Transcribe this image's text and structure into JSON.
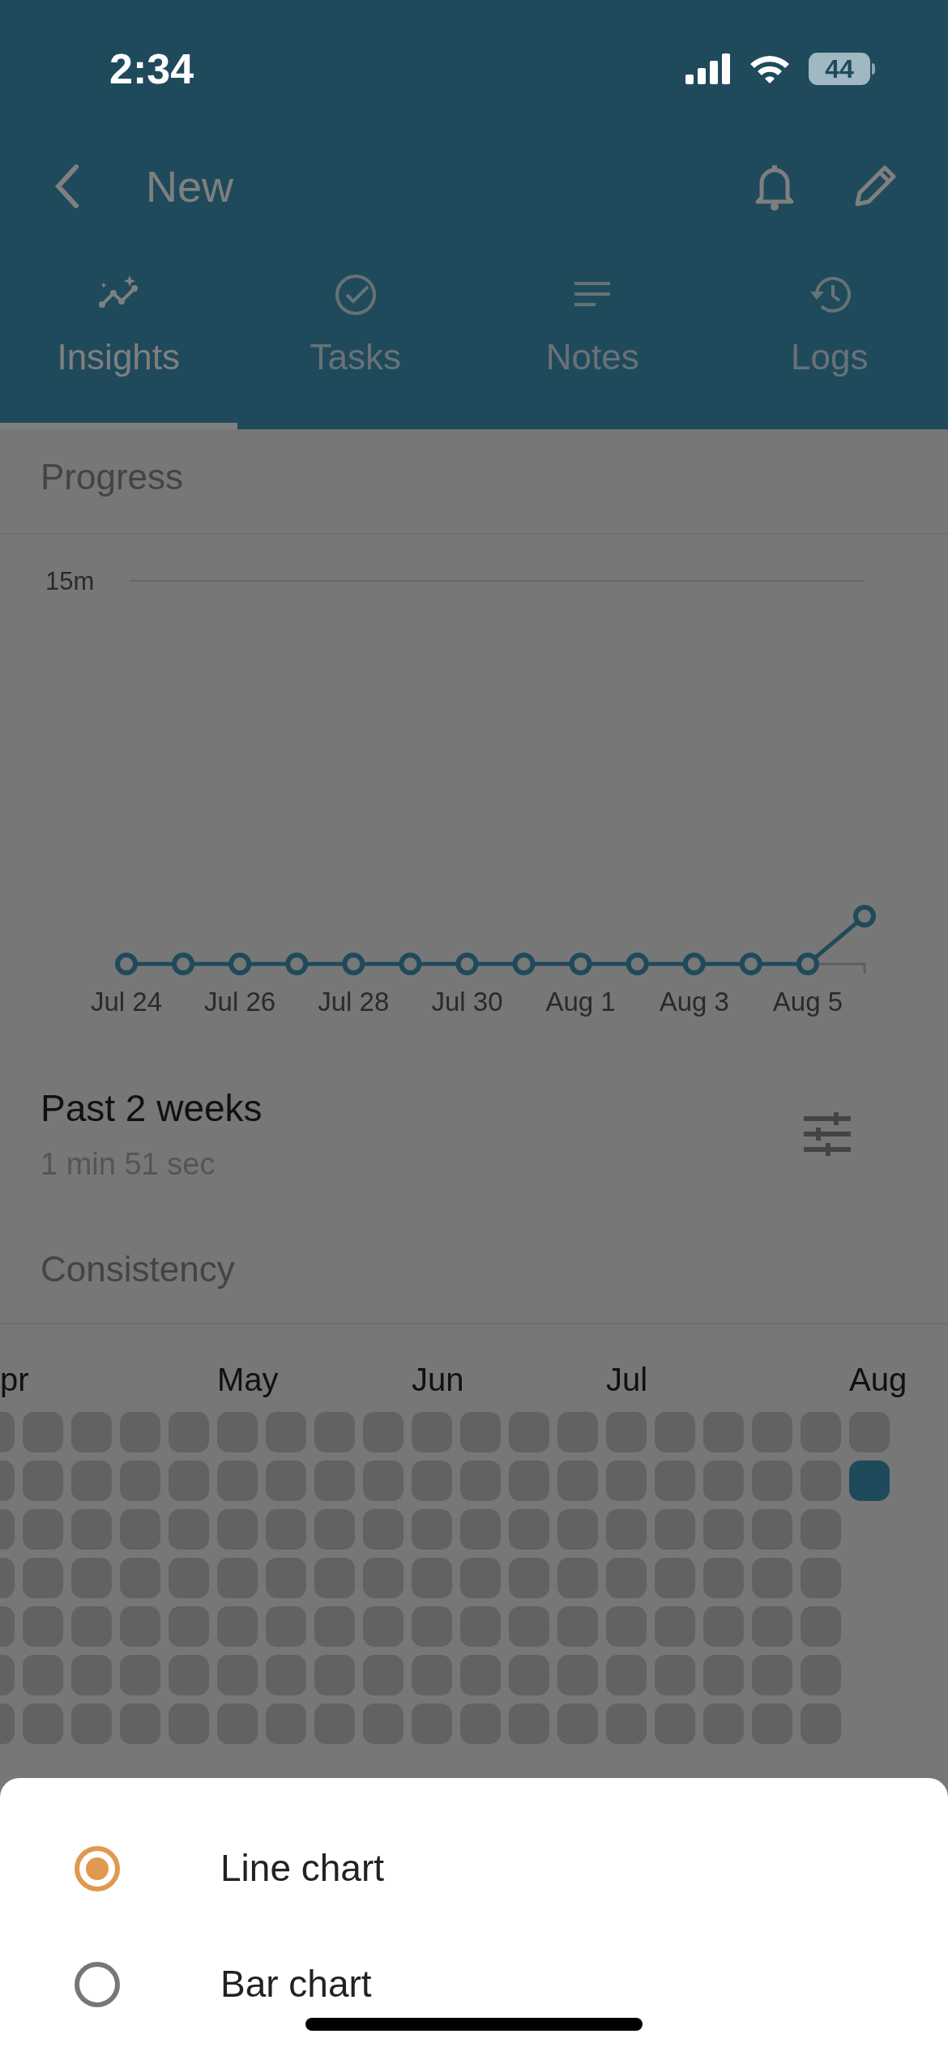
{
  "status_bar": {
    "time": "2:34",
    "battery": "44"
  },
  "header": {
    "title": "New"
  },
  "tabs": [
    {
      "label": "Insights",
      "selected": true
    },
    {
      "label": "Tasks",
      "selected": false
    },
    {
      "label": "Notes",
      "selected": false
    },
    {
      "label": "Logs",
      "selected": false
    }
  ],
  "progress": {
    "title": "Progress",
    "chart": {
      "y_label": "15m",
      "x_labels": [
        "Jul 24",
        "Jul 26",
        "Jul 28",
        "Jul 30",
        "Aug 1",
        "Aug 3",
        "Aug 5"
      ]
    },
    "period": "Past 2 weeks",
    "total": "1 min 51 sec"
  },
  "consistency": {
    "title": "Consistency",
    "weeks": [
      {
        "month": "pr",
        "days": [
          false,
          false,
          false,
          false,
          false,
          false,
          false
        ]
      },
      {
        "days": [
          false,
          false,
          false,
          false,
          false,
          false,
          false
        ]
      },
      {
        "days": [
          false,
          false,
          false,
          false,
          false,
          false,
          false
        ]
      },
      {
        "days": [
          false,
          false,
          false,
          false,
          false,
          false,
          false
        ]
      },
      {
        "days": [
          false,
          false,
          false,
          false,
          false,
          false,
          false
        ]
      },
      {
        "month": "May",
        "days": [
          false,
          false,
          false,
          false,
          false,
          false,
          false
        ]
      },
      {
        "days": [
          false,
          false,
          false,
          false,
          false,
          false,
          false
        ]
      },
      {
        "days": [
          false,
          false,
          false,
          false,
          false,
          false,
          false
        ]
      },
      {
        "days": [
          false,
          false,
          false,
          false,
          false,
          false,
          false
        ]
      },
      {
        "month": "Jun",
        "days": [
          false,
          false,
          false,
          false,
          false,
          false,
          false
        ]
      },
      {
        "days": [
          false,
          false,
          false,
          false,
          false,
          false,
          false
        ]
      },
      {
        "days": [
          false,
          false,
          false,
          false,
          false,
          false,
          false
        ]
      },
      {
        "days": [
          false,
          false,
          false,
          false,
          false,
          false,
          false
        ]
      },
      {
        "month": "Jul",
        "days": [
          false,
          false,
          false,
          false,
          false,
          false,
          false
        ]
      },
      {
        "days": [
          false,
          false,
          false,
          false,
          false,
          false,
          false
        ]
      },
      {
        "days": [
          false,
          false,
          false,
          false,
          false,
          false,
          false
        ]
      },
      {
        "days": [
          false,
          false,
          false,
          false,
          false,
          false,
          false
        ]
      },
      {
        "days": [
          false,
          false,
          false,
          false,
          false,
          false,
          false
        ]
      },
      {
        "month": "Aug",
        "days": [
          false,
          true
        ]
      }
    ]
  },
  "sheet": {
    "options": [
      {
        "label": "Line chart",
        "selected": true
      },
      {
        "label": "Bar chart",
        "selected": false
      }
    ]
  }
}
